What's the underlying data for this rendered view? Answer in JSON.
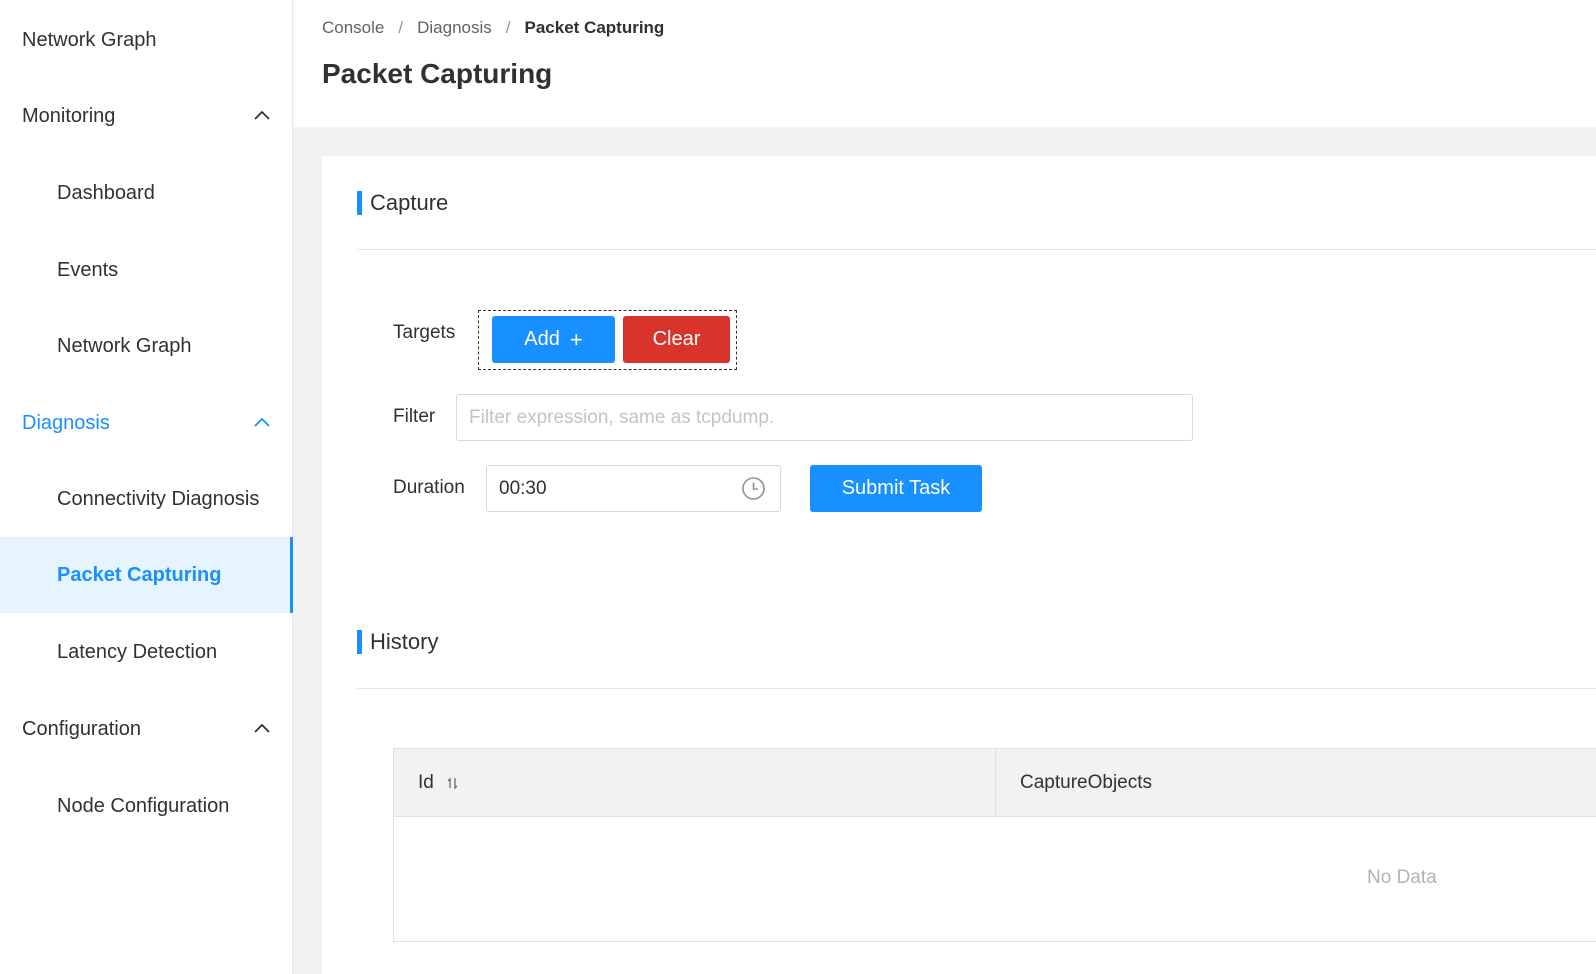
{
  "sidebar": {
    "items": [
      {
        "label": "Network Graph"
      },
      {
        "label": "Monitoring"
      },
      {
        "label": "Dashboard"
      },
      {
        "label": "Events"
      },
      {
        "label": "Network Graph"
      },
      {
        "label": "Diagnosis"
      },
      {
        "label": "Connectivity Diagnosis"
      },
      {
        "label": "Packet Capturing"
      },
      {
        "label": "Latency Detection"
      },
      {
        "label": "Configuration"
      },
      {
        "label": "Node Configuration"
      }
    ],
    "active_group": "Diagnosis",
    "selected_item": "Packet Capturing"
  },
  "header": {
    "breadcrumb": [
      "Console",
      "Diagnosis",
      "Packet Capturing"
    ],
    "breadcrumb_separator": "/",
    "title": "Packet Capturing"
  },
  "capture": {
    "title": "Capture",
    "targets_label": "Targets",
    "add_label": "Add",
    "add_icon": "+",
    "clear_label": "Clear",
    "filter_label": "Filter",
    "filter_value": "",
    "filter_placeholder": "Filter expression, same as tcpdump.",
    "duration_label": "Duration",
    "duration_value": "00:30",
    "submit_label": "Submit Task"
  },
  "history": {
    "title": "History",
    "columns": [
      "Id",
      "CaptureObjects"
    ],
    "empty_text": "No Data"
  },
  "colors": {
    "accent": "#1890ff",
    "danger": "#d9342b",
    "selected_bg": "#e6f4ff",
    "content_bg": "#f2f2f2"
  },
  "icons": {
    "group_toggle": "chevron-up-icon",
    "duration_picker": "clock-icon",
    "id_sort": "sort-icon"
  }
}
